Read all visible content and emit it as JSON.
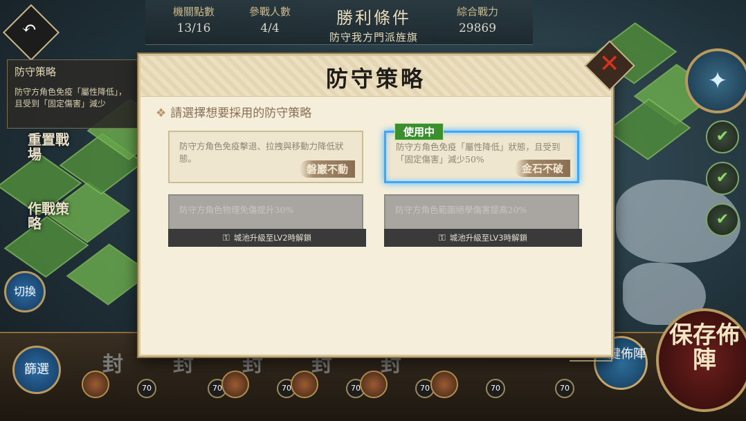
{
  "hud": {
    "mechanism_label": "機關點數",
    "mechanism_value": "13/16",
    "participants_label": "參戰人數",
    "participants_value": "4/4",
    "victory_label": "勝利條件",
    "victory_value": "防守我方門派旌旗",
    "power_label": "綜合戰力",
    "power_value": "29869"
  },
  "side_panel": {
    "title": "防守策略",
    "text": "防守方角色免疫「屬性降低」，且受到「固定傷害」減少"
  },
  "side_buttons": {
    "reset": "重置戰場",
    "tactics": "作戰策略",
    "switch": "切換",
    "filter": "篩選",
    "deploy": "一鍵佈陣",
    "save": "保存佈陣"
  },
  "modal": {
    "title": "防守策略",
    "subtitle": "請選擇想要採用的防守策略",
    "in_use_label": "使用中",
    "cards": [
      {
        "desc": "防守方角色免疫擊退、拉拽與移動力降低狀態。",
        "name": "磐巖不動"
      },
      {
        "desc": "防守方角色免疫「屬性降低」狀態，且受到「固定傷害」減少50%",
        "name": "金石不破"
      },
      {
        "desc": "防守方角色物理免傷提升30%",
        "lock": "城池升級至LV2時解鎖"
      },
      {
        "desc": "防守方角色範圍絕學傷害提高20%",
        "lock": "城池升級至LV3時解鎖"
      }
    ]
  },
  "slots": [
    {
      "seal": "封",
      "level": "70"
    },
    {
      "seal": "封",
      "level": "70"
    },
    {
      "seal": "封",
      "level": "70"
    },
    {
      "seal": "封",
      "level": "70"
    },
    {
      "seal": "封",
      "level": "70"
    },
    {
      "seal": "",
      "level": "70"
    },
    {
      "seal": "",
      "level": "70"
    }
  ],
  "colors": {
    "active_border": "#3fa6ff",
    "in_use_bg": "#3a8f2f",
    "close_x": "#d8321e"
  }
}
